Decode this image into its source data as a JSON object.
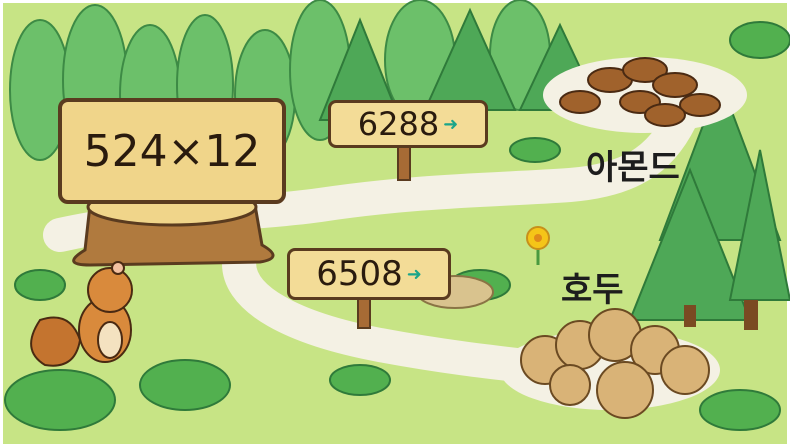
{
  "problem": {
    "expression": "524×12"
  },
  "choices": [
    {
      "value": "6288",
      "nut": "아몬드",
      "nut_icon": "almond-pile-icon"
    },
    {
      "value": "6508",
      "nut": "호두",
      "nut_icon": "walnut-pile-icon"
    }
  ],
  "arrow_glyph": "➜",
  "colors": {
    "grass": "#bfe07a",
    "path": "#f4f1e4",
    "sign": "#f3dc97",
    "wood": "#5a3b1f",
    "arrow": "#1aa58a",
    "tree": "#5bb85f"
  }
}
